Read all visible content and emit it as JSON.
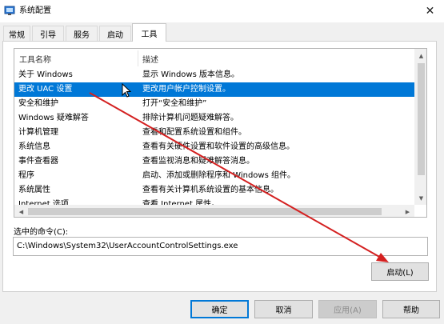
{
  "window": {
    "title": "系统配置",
    "close_glyph": "✕"
  },
  "tabs": [
    {
      "label": "常规",
      "active": false
    },
    {
      "label": "引导",
      "active": false
    },
    {
      "label": "服务",
      "active": false
    },
    {
      "label": "启动",
      "active": false
    },
    {
      "label": "工具",
      "active": true
    }
  ],
  "tools_list": {
    "columns": [
      "工具名称",
      "描述"
    ],
    "rows": [
      {
        "name": "关于 Windows",
        "desc": "显示 Windows 版本信息。",
        "selected": false
      },
      {
        "name": "更改 UAC 设置",
        "desc": "更改用户帐户控制设置。",
        "selected": true
      },
      {
        "name": "安全和维护",
        "desc": "打开“安全和维护”",
        "selected": false
      },
      {
        "name": "Windows 疑难解答",
        "desc": "排除计算机问题疑难解答。",
        "selected": false
      },
      {
        "name": "计算机管理",
        "desc": "查看和配置系统设置和组件。",
        "selected": false
      },
      {
        "name": "系统信息",
        "desc": "查看有关硬件设置和软件设置的高级信息。",
        "selected": false
      },
      {
        "name": "事件查看器",
        "desc": "查看监视消息和疑难解答消息。",
        "selected": false
      },
      {
        "name": "程序",
        "desc": "启动、添加或删除程序和 Windows 组件。",
        "selected": false
      },
      {
        "name": "系统属性",
        "desc": "查看有关计算机系统设置的基本信息。",
        "selected": false
      },
      {
        "name": "Internet 选项",
        "desc": "查看 Internet 属性。",
        "selected": false
      }
    ]
  },
  "command": {
    "label": "选中的命令(C):",
    "value": "C:\\Windows\\System32\\UserAccountControlSettings.exe"
  },
  "buttons": {
    "launch": "启动(L)",
    "ok": "确定",
    "cancel": "取消",
    "apply": "应用(A)",
    "help": "帮助"
  },
  "colors": {
    "selection": "#0078d7",
    "annotation_arrow": "#d42020"
  }
}
